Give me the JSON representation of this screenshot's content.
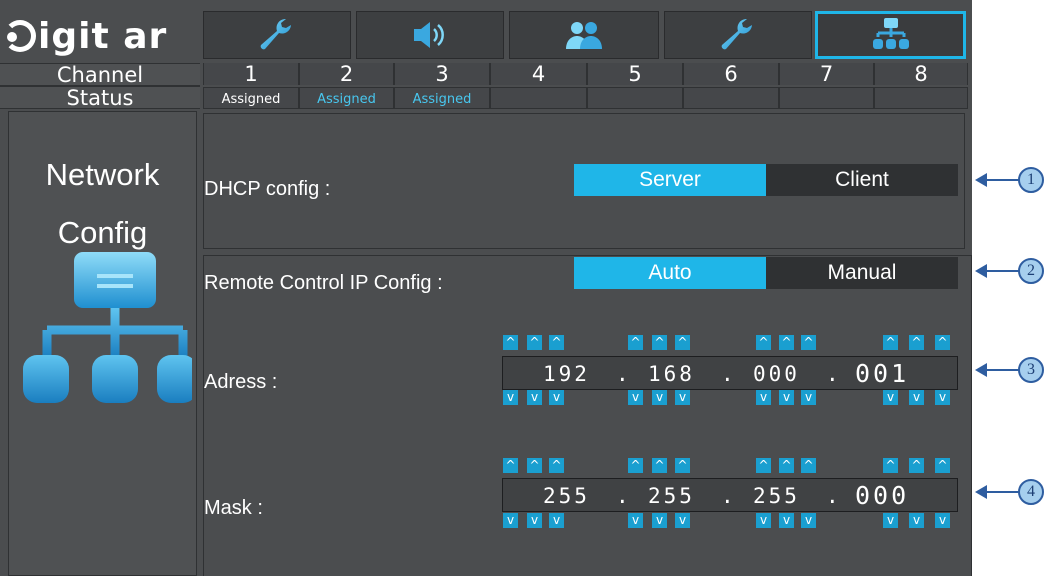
{
  "logo_text": "igit ar",
  "tabs": [
    {
      "icon": "wrench-icon",
      "active": false
    },
    {
      "icon": "speaker-icon",
      "active": false
    },
    {
      "icon": "users-icon",
      "active": false
    },
    {
      "icon": "wrench-icon",
      "active": false
    },
    {
      "icon": "network-icon",
      "active": true
    }
  ],
  "grid": {
    "channel_label": "Channel",
    "status_label": "Status",
    "channels": [
      "1",
      "2",
      "3",
      "4",
      "5",
      "6",
      "7",
      "8"
    ],
    "status": [
      "Assigned",
      "Assigned",
      "Assigned",
      "",
      "",
      "",
      "",
      ""
    ]
  },
  "sidebar": {
    "title_line1": "Network",
    "title_line2": "Config",
    "icon": "network-icon"
  },
  "dhcp": {
    "label": "DHCP config :",
    "options": [
      "Server",
      "Client"
    ],
    "selected": "Server"
  },
  "remote": {
    "label": "Remote Control IP Config :",
    "options": [
      "Auto",
      "Manual"
    ],
    "selected": "Auto"
  },
  "address": {
    "label": "Adress :",
    "octets": [
      "192",
      "168",
      "000",
      "001"
    ],
    "separator": "."
  },
  "mask": {
    "label": "Mask :",
    "octets": [
      "255",
      "255",
      "255",
      "000"
    ],
    "separator": "."
  },
  "arrows": {
    "up": "^",
    "down": "v"
  },
  "callouts": [
    "1",
    "2",
    "3",
    "4"
  ],
  "colors": {
    "accent": "#1fb6e8",
    "panel": "#4b4d4f",
    "dark": "#2f3133",
    "callout": "#2e5da0"
  }
}
